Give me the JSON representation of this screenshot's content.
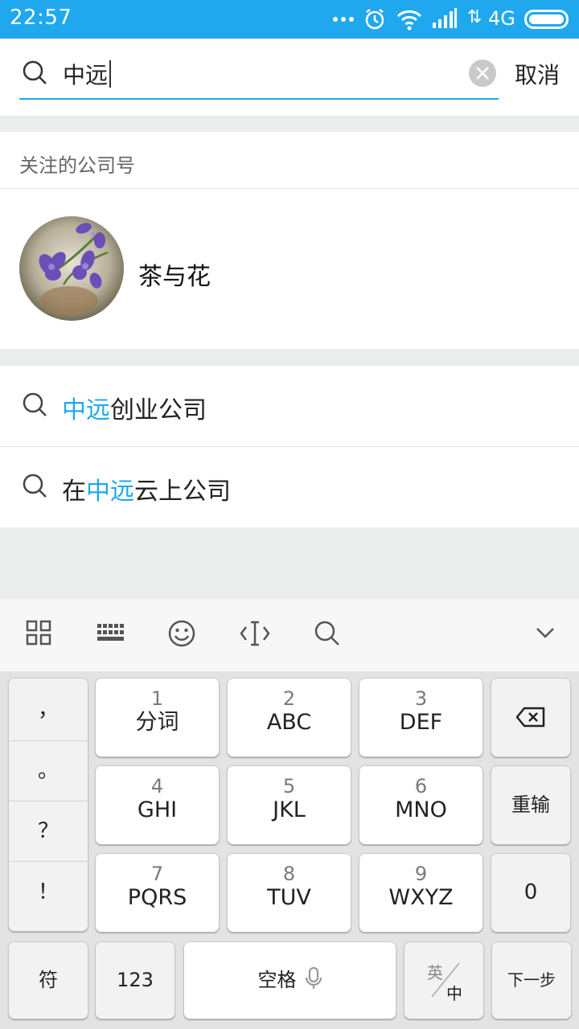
{
  "status_bar": {
    "time": "22:57",
    "network": "4G"
  },
  "search": {
    "query": "中远",
    "cancel_label": "取消"
  },
  "followed": {
    "section_title": "关注的公司号",
    "items": [
      {
        "name": "茶与花"
      }
    ]
  },
  "suggestions": [
    {
      "prefix": "",
      "highlight": "中远",
      "suffix": "创业公司"
    },
    {
      "prefix": "在",
      "highlight": "中远",
      "suffix": "云上公司"
    }
  ],
  "colors": {
    "accent": "#1fa8ee",
    "status_bar": "#1fa8ee"
  },
  "keyboard": {
    "toolbar_icons": [
      "grid-icon",
      "keyboard-icon",
      "emoji-icon",
      "cursor-icon",
      "search-icon",
      "chevron-down-icon"
    ],
    "punctuation": [
      "，",
      "。",
      "？",
      "！"
    ],
    "keys": [
      {
        "num": "1",
        "label": "分词"
      },
      {
        "num": "2",
        "label": "ABC"
      },
      {
        "num": "3",
        "label": "DEF"
      },
      {
        "num": "4",
        "label": "GHI"
      },
      {
        "num": "5",
        "label": "JKL"
      },
      {
        "num": "6",
        "label": "MNO"
      },
      {
        "num": "7",
        "label": "PQRS"
      },
      {
        "num": "8",
        "label": "TUV"
      },
      {
        "num": "9",
        "label": "WXYZ"
      }
    ],
    "reinput_label": "重输",
    "zero_label": "0",
    "symbols_label": "符",
    "numbers_label": "123",
    "space_label": "空格",
    "lang_en": "英",
    "lang_zh": "中",
    "next_label": "下一步"
  }
}
